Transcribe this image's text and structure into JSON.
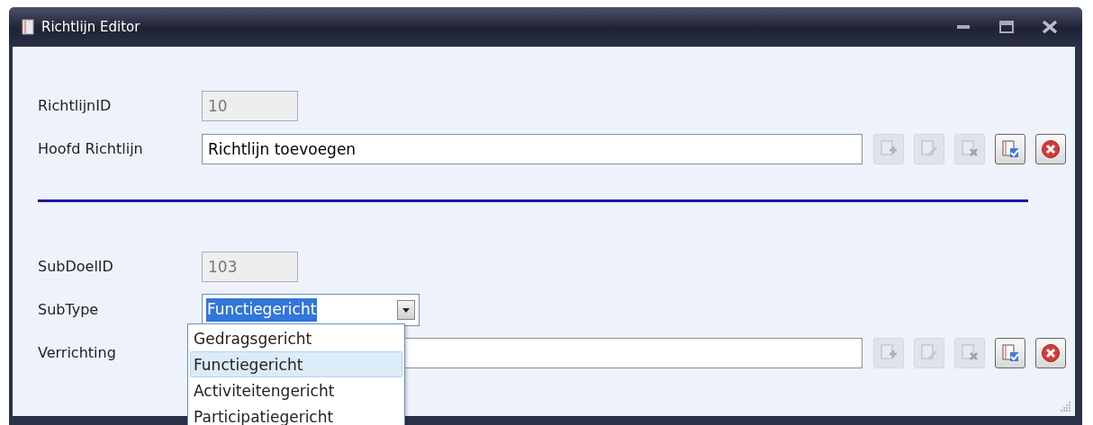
{
  "window": {
    "title": "Richtlijn Editor"
  },
  "main": {
    "fields": [
      {
        "label": "RichtlijnID",
        "value": "10",
        "disabled": true,
        "kind": "short"
      },
      {
        "label": "Hoofd Richtlijn",
        "value": "Richtlijn toevoegen",
        "kind": "long"
      }
    ],
    "buttons": [
      {
        "kind": "add",
        "disabled": true
      },
      {
        "kind": "edit",
        "disabled": true
      },
      {
        "kind": "delete",
        "disabled": true
      },
      {
        "kind": "save",
        "disabled": false
      },
      {
        "kind": "cancel",
        "disabled": false
      }
    ]
  },
  "sub": {
    "fields": [
      {
        "label": "SubDoelID",
        "value": "103",
        "disabled": true,
        "kind": "short"
      },
      {
        "label": "SubType",
        "value": "Functiegericht",
        "kind": "combo",
        "expanded": true,
        "options": [
          {
            "label": "Gedragsgericht",
            "selected": false
          },
          {
            "label": "Functiegericht",
            "selected": true
          },
          {
            "label": "Activiteitengericht",
            "selected": false
          },
          {
            "label": "Participatiegericht",
            "selected": false
          }
        ]
      },
      {
        "label": "Verrichting",
        "kind": "long"
      }
    ],
    "buttons": [
      {
        "kind": "add",
        "disabled": true
      },
      {
        "kind": "edit",
        "disabled": true
      },
      {
        "kind": "delete",
        "disabled": true
      },
      {
        "kind": "save",
        "disabled": false
      },
      {
        "kind": "cancel",
        "disabled": false
      }
    ]
  }
}
